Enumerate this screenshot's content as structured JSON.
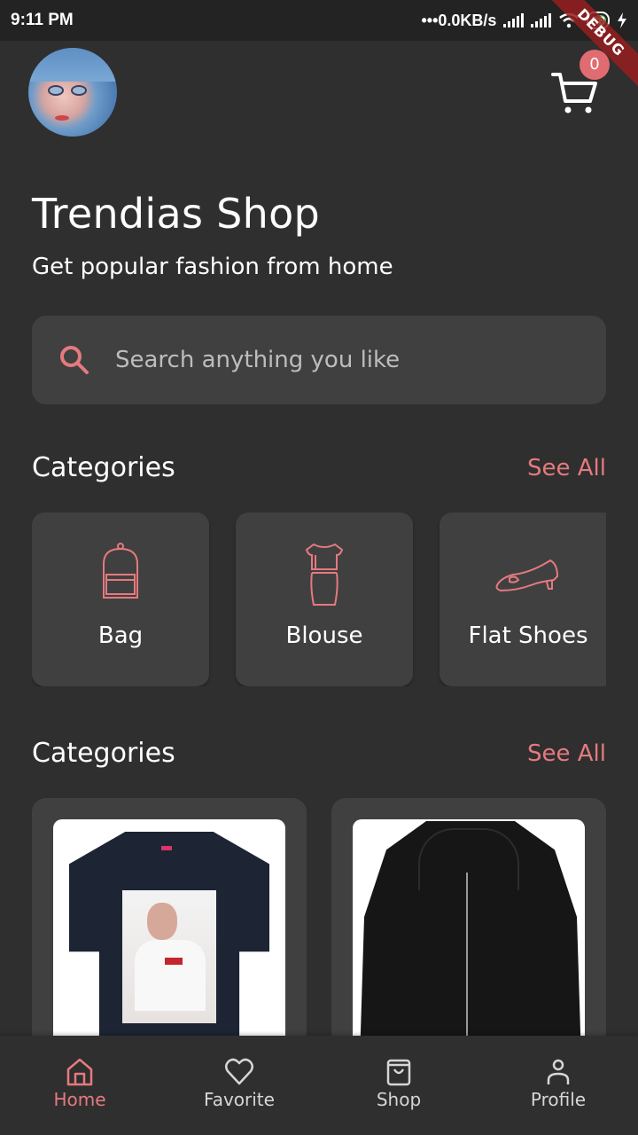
{
  "status_bar": {
    "time": "9:11 PM",
    "network_speed": "0.0KB/s",
    "battery_level": "38",
    "debug_banner": "DEBUG"
  },
  "header": {
    "avatar_alt": "user-avatar",
    "cart_badge": "0"
  },
  "hero": {
    "title": "Trendias Shop",
    "subtitle": "Get popular fashion from home"
  },
  "search": {
    "placeholder": "Search anything you like",
    "value": ""
  },
  "categories_section": {
    "title": "Categories",
    "see_all": "See All",
    "items": [
      {
        "label": "Bag",
        "icon": "backpack-icon"
      },
      {
        "label": "Blouse",
        "icon": "dress-icon"
      },
      {
        "label": "Flat Shoes",
        "icon": "shoe-icon"
      }
    ]
  },
  "products_section": {
    "title": "Categories",
    "see_all": "See All",
    "items": [
      {
        "name": "t-shirt",
        "image": "black t-shirt with photo print"
      },
      {
        "name": "jacket",
        "image": "black zip hooded jacket"
      }
    ]
  },
  "bottom_nav": {
    "items": [
      {
        "label": "Home",
        "icon": "home-icon",
        "active": true
      },
      {
        "label": "Favorite",
        "icon": "heart-icon",
        "active": false
      },
      {
        "label": "Shop",
        "icon": "shopping-bag-icon",
        "active": false
      },
      {
        "label": "Profile",
        "icon": "person-icon",
        "active": false
      }
    ]
  },
  "colors": {
    "background": "#2f2f2f",
    "card": "#404040",
    "accent": "#e57a7f",
    "text": "#ffffff",
    "muted_text": "#bdbdbd"
  }
}
